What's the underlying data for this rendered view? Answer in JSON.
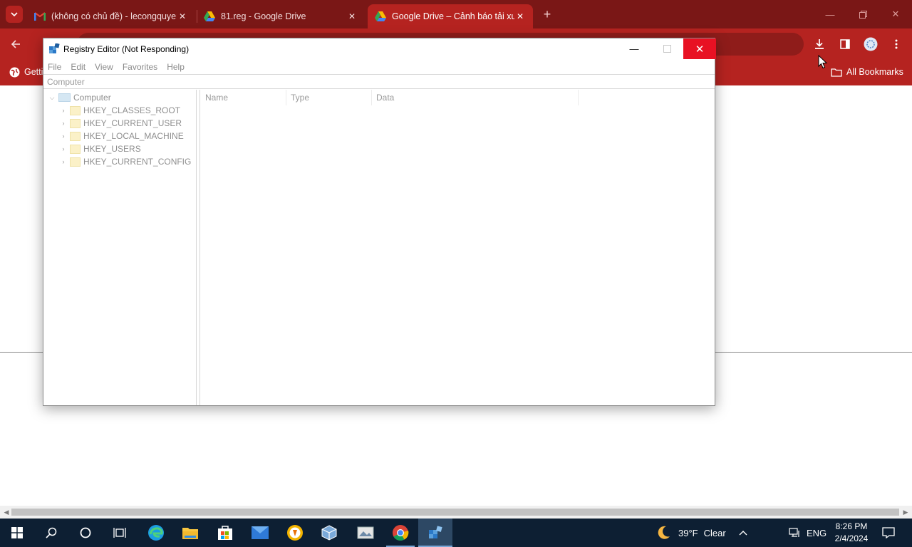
{
  "browser": {
    "tabs": [
      {
        "title": "(không có chủ đề) - lecongquyen",
        "icon": "gmail-icon",
        "active": false
      },
      {
        "title": "81.reg - Google Drive",
        "icon": "google-drive-icon",
        "active": false
      },
      {
        "title": "Google Drive – Cảnh báo tải xuống",
        "icon": "google-drive-icon",
        "active": true
      }
    ],
    "new_tab": "+",
    "bookmarks": {
      "left_item": "Getting Started",
      "all_bookmarks": "All Bookmarks"
    },
    "colors": {
      "tabstrip": "#7a1716",
      "toolbar": "#b52320"
    }
  },
  "regedit": {
    "title": "Registry Editor (Not Responding)",
    "menu": [
      "File",
      "Edit",
      "View",
      "Favorites",
      "Help"
    ],
    "address": "Computer",
    "tree_root": "Computer",
    "tree_items": [
      "HKEY_CLASSES_ROOT",
      "HKEY_CURRENT_USER",
      "HKEY_LOCAL_MACHINE",
      "HKEY_USERS",
      "HKEY_CURRENT_CONFIG"
    ],
    "columns": [
      "Name",
      "Type",
      "Data"
    ]
  },
  "taskbar": {
    "weather": {
      "temp": "39°F",
      "condition": "Clear"
    },
    "language": "ENG",
    "time": "8:26 PM",
    "date": "2/4/2024"
  }
}
